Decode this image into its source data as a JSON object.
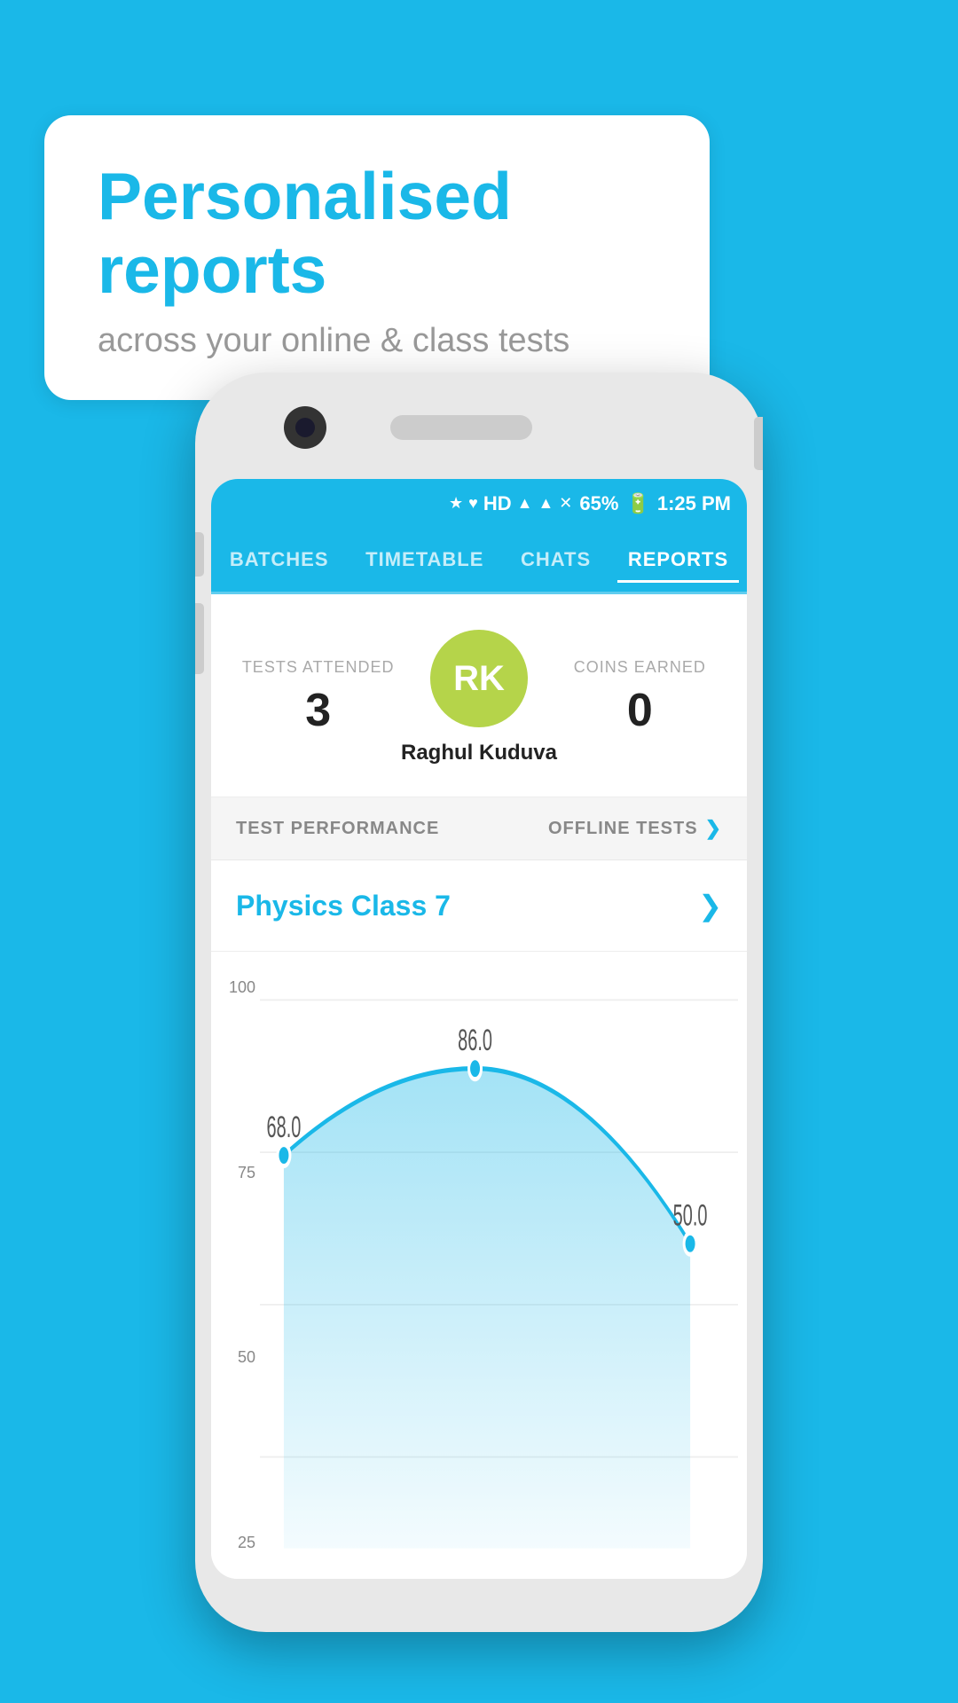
{
  "background_color": "#1ab8e8",
  "speech_bubble": {
    "title": "Personalised reports",
    "subtitle": "across your online & class tests"
  },
  "status_bar": {
    "battery": "65%",
    "time": "1:25 PM",
    "icons": [
      "bluetooth",
      "vibrate",
      "hd",
      "wifi",
      "signal",
      "mute",
      "battery"
    ]
  },
  "nav_tabs": [
    {
      "id": "batches",
      "label": "BATCHES",
      "active": false
    },
    {
      "id": "timetable",
      "label": "TIMETABLE",
      "active": false
    },
    {
      "id": "chats",
      "label": "CHATS",
      "active": false
    },
    {
      "id": "reports",
      "label": "REPORTS",
      "active": true
    }
  ],
  "user": {
    "name": "Raghul Kuduva",
    "initials": "RK",
    "avatar_color": "#b5d44a",
    "tests_attended_label": "TESTS ATTENDED",
    "tests_attended_value": "3",
    "coins_earned_label": "COINS EARNED",
    "coins_earned_value": "0"
  },
  "performance": {
    "section_label": "TEST PERFORMANCE",
    "filter_label": "OFFLINE TESTS",
    "class_name": "Physics Class 7"
  },
  "chart": {
    "y_labels": [
      "100",
      "75",
      "50",
      "25"
    ],
    "data_points": [
      {
        "label": "",
        "value": 68.0,
        "x_pct": 5
      },
      {
        "label": "",
        "value": 86.0,
        "x_pct": 45
      },
      {
        "label": "",
        "value": 50.0,
        "x_pct": 90
      }
    ],
    "point_labels": [
      "68.0",
      "86.0",
      "50.0"
    ]
  }
}
